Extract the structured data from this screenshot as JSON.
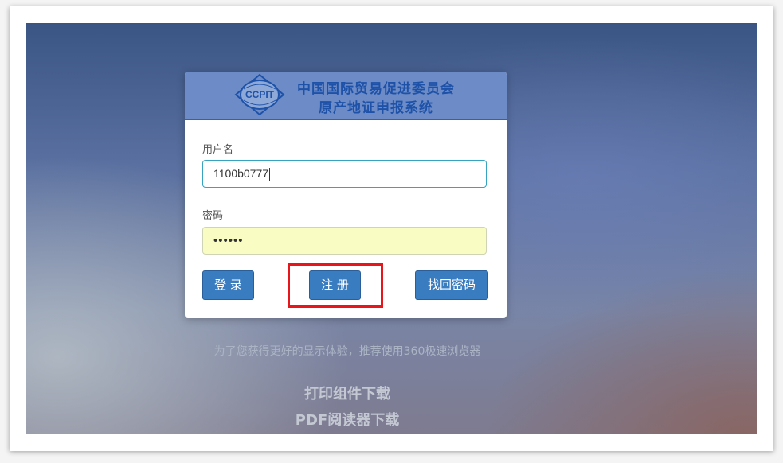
{
  "header": {
    "logo_text": "CCPIT",
    "title_line1": "中国国际贸易促进委员会",
    "title_line2": "原产地证申报系统"
  },
  "form": {
    "username_label": "用户名",
    "username_value": "1100b0777",
    "password_label": "密码",
    "password_value": "••••••"
  },
  "buttons": {
    "login": "登 录",
    "register": "注 册",
    "forgot_password": "找回密码"
  },
  "tip": "为了您获得更好的显示体验，推荐使用360极速浏览器",
  "downloads": {
    "print_component": "打印组件下载",
    "pdf_reader": "PDF阅读器下载"
  },
  "colors": {
    "header_bg": "#6d8cc7",
    "title_text": "#1e52a8",
    "button_bg": "#3a7cc0",
    "highlight": "#e8161a",
    "password_bg": "#f9fdc3"
  }
}
